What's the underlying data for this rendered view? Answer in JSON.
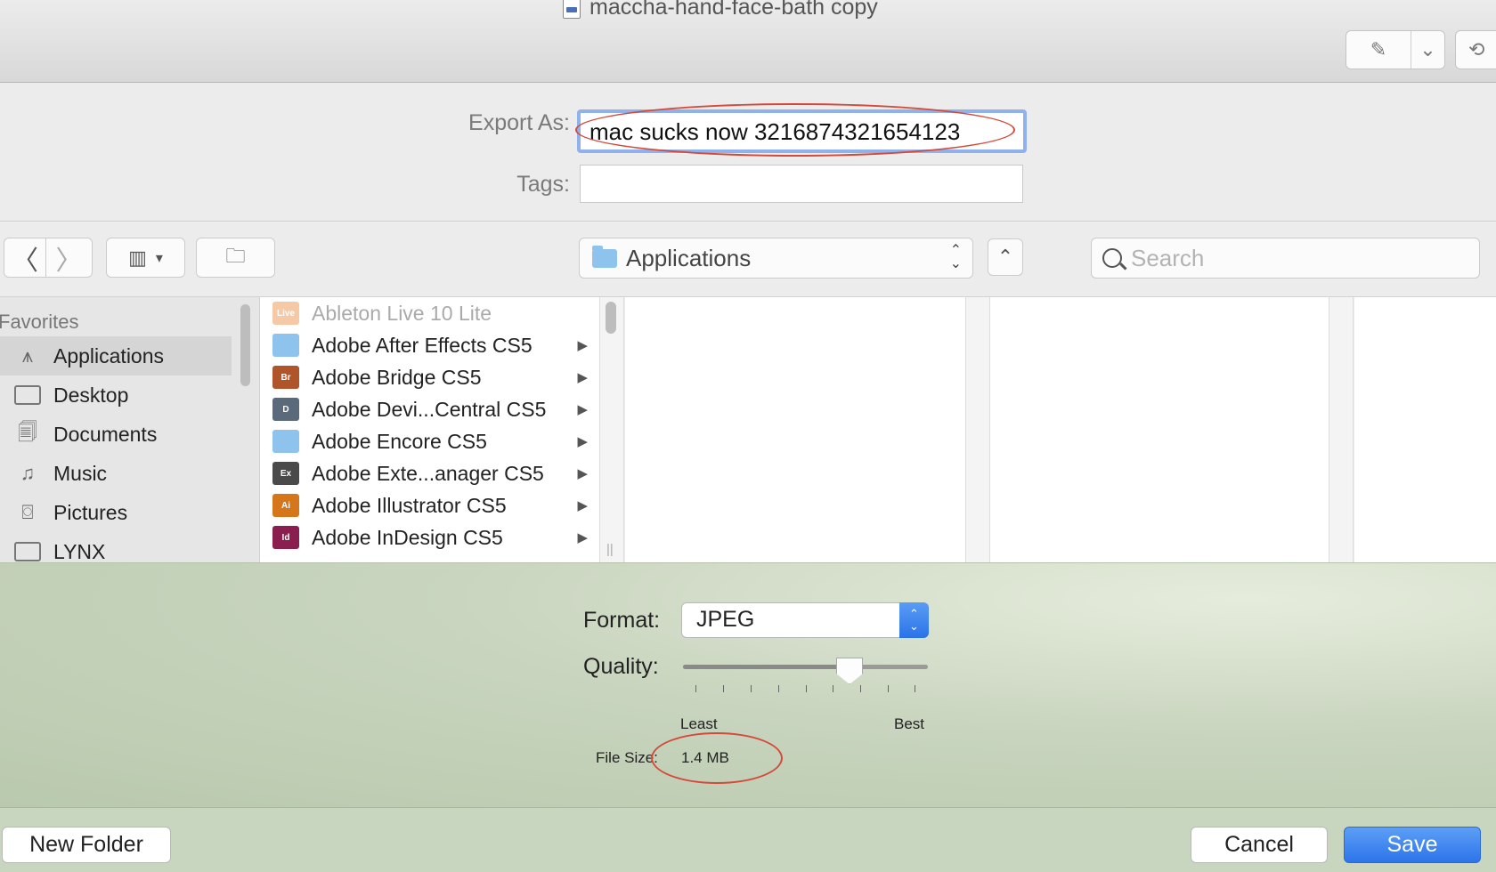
{
  "window": {
    "title": "maccha-hand-face-bath copy",
    "toolbar_icons": [
      "pen-markup-icon",
      "chevron-down-icon",
      "rotate-icon"
    ]
  },
  "export": {
    "export_as_label": "Export As:",
    "export_as_value": "mac sucks now 3216874321654123",
    "tags_label": "Tags:",
    "tags_value": ""
  },
  "toolbar": {
    "back_glyph": "〈",
    "forward_glyph": "〉",
    "location": "Applications",
    "search_placeholder": "Search"
  },
  "sidebar": {
    "header": "Favorites",
    "items": [
      {
        "label": "Applications",
        "icon": "applications-icon",
        "selected": true
      },
      {
        "label": "Desktop",
        "icon": "desktop-icon"
      },
      {
        "label": "Documents",
        "icon": "documents-icon"
      },
      {
        "label": "Music",
        "icon": "music-icon"
      },
      {
        "label": "Pictures",
        "icon": "camera-icon"
      },
      {
        "label": "LYNX",
        "icon": "folder-icon"
      }
    ]
  },
  "files": [
    {
      "name": "Ableton Live 10 Lite",
      "dim": true,
      "badge": "Live",
      "color": "#f5c9a6"
    },
    {
      "name": "Adobe After Effects CS5",
      "badge": "",
      "color": "#8ec3ee",
      "folder": true
    },
    {
      "name": "Adobe Bridge CS5",
      "badge": "Br",
      "color": "#b0542a"
    },
    {
      "name": "Adobe Devi...Central CS5",
      "badge": "D",
      "color": "#5a6a7a"
    },
    {
      "name": "Adobe Encore CS5",
      "badge": "",
      "color": "#8ec3ee",
      "folder": true
    },
    {
      "name": "Adobe Exte...anager CS5",
      "badge": "Ex",
      "color": "#4a4a4a"
    },
    {
      "name": "Adobe Illustrator CS5",
      "badge": "Ai",
      "color": "#d6761b"
    },
    {
      "name": "Adobe InDesign CS5",
      "badge": "Id",
      "color": "#8a1e4e"
    }
  ],
  "options": {
    "format_label": "Format:",
    "format_value": "JPEG",
    "quality_label": "Quality:",
    "quality_level": 0.68,
    "least_label": "Least",
    "best_label": "Best",
    "file_size_label": "File Size:",
    "file_size_value": "1.4 MB"
  },
  "buttons": {
    "new_folder": "New Folder",
    "cancel": "Cancel",
    "save": "Save"
  },
  "colors": {
    "accent": "#2c74ea",
    "annotation": "#d44a3a"
  }
}
